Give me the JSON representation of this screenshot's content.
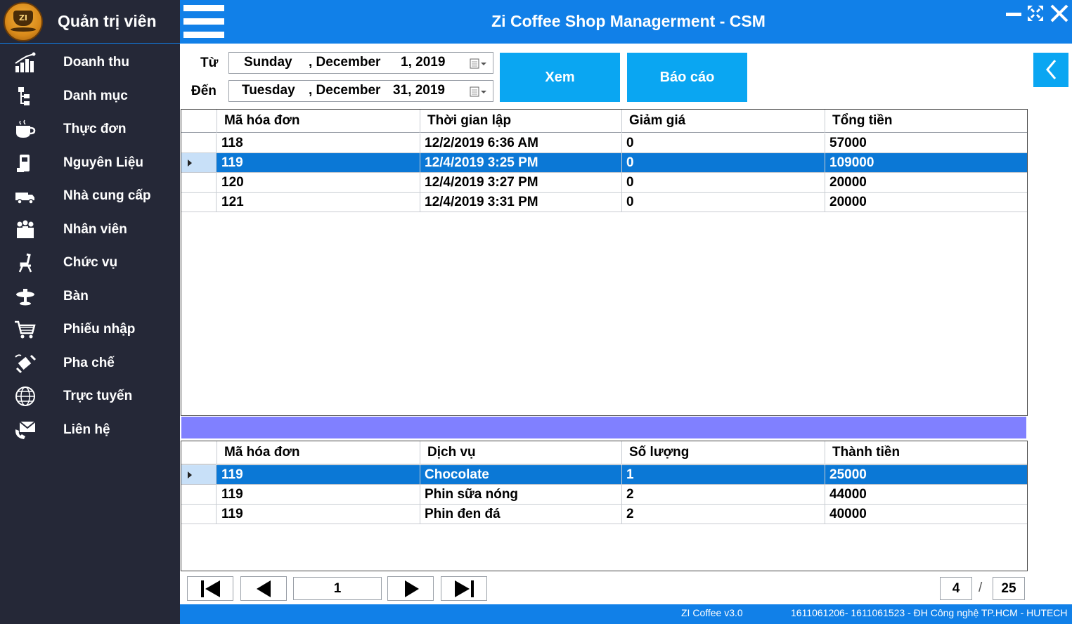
{
  "sidebar": {
    "title": "Quản trị viên",
    "logo_text": "ZI",
    "items": [
      {
        "label": "Doanh thu",
        "icon": "chart-icon"
      },
      {
        "label": "Danh mục",
        "icon": "tree-icon"
      },
      {
        "label": "Thực đơn",
        "icon": "coffee-cup-icon"
      },
      {
        "label": "Nguyên Liệu",
        "icon": "ingredient-icon"
      },
      {
        "label": "Nhà cung cấp",
        "icon": "truck-icon"
      },
      {
        "label": "Nhân viên",
        "icon": "people-icon"
      },
      {
        "label": "Chức vụ",
        "icon": "chair-icon"
      },
      {
        "label": "Bàn",
        "icon": "table-icon"
      },
      {
        "label": "Phiếu nhập",
        "icon": "cart-icon"
      },
      {
        "label": "Pha chế",
        "icon": "satellite-icon"
      },
      {
        "label": "Trực tuyến",
        "icon": "globe-icon"
      },
      {
        "label": "Liên hệ",
        "icon": "contact-icon"
      }
    ]
  },
  "header": {
    "title": "Zi Coffee Shop Managerment - CSM"
  },
  "filter": {
    "from_label": "Từ",
    "to_label": "Đến",
    "from": {
      "weekday": "Sunday",
      "month": ", December",
      "day_year": "1, 2019"
    },
    "to": {
      "weekday": "Tuesday",
      "month": ", December",
      "day_year": "31, 2019"
    },
    "view_button": "Xem",
    "report_button": "Báo cáo"
  },
  "invoices": {
    "columns": [
      "Mã hóa đơn",
      "Thời gian lập",
      "Giảm giá",
      "Tổng tiền"
    ],
    "rows": [
      [
        "118",
        "12/2/2019 6:36 AM",
        "0",
        "57000"
      ],
      [
        "119",
        "12/4/2019 3:25 PM",
        "0",
        "109000"
      ],
      [
        "120",
        "12/4/2019 3:27 PM",
        "0",
        "20000"
      ],
      [
        "121",
        "12/4/2019 3:31 PM",
        "0",
        "20000"
      ]
    ],
    "selected_index": 1
  },
  "details": {
    "columns": [
      "Mã hóa đơn",
      "Dịch vụ",
      "Số lượng",
      "Thành tiền"
    ],
    "rows": [
      [
        "119",
        "Chocolate",
        "1",
        "25000"
      ],
      [
        "119",
        "Phin sữa nóng",
        "2",
        "44000"
      ],
      [
        "119",
        "Phin đen đá",
        "2",
        "40000"
      ]
    ],
    "selected_index": 0
  },
  "pager": {
    "current_page": "1",
    "page_count_current": "4",
    "separator": "/",
    "page_count_total": "25"
  },
  "status": {
    "version": "ZI Coffee v3.0",
    "credit": "1611061206- 1611061523 - ĐH Công nghệ TP.HCM - HUTECH"
  },
  "colors": {
    "sidebar_bg": "#252837",
    "topbar_bg": "#1180e8",
    "button_bg": "#0aa6f2",
    "selected_row": "#0b78d6",
    "divider": "#8080ff"
  }
}
